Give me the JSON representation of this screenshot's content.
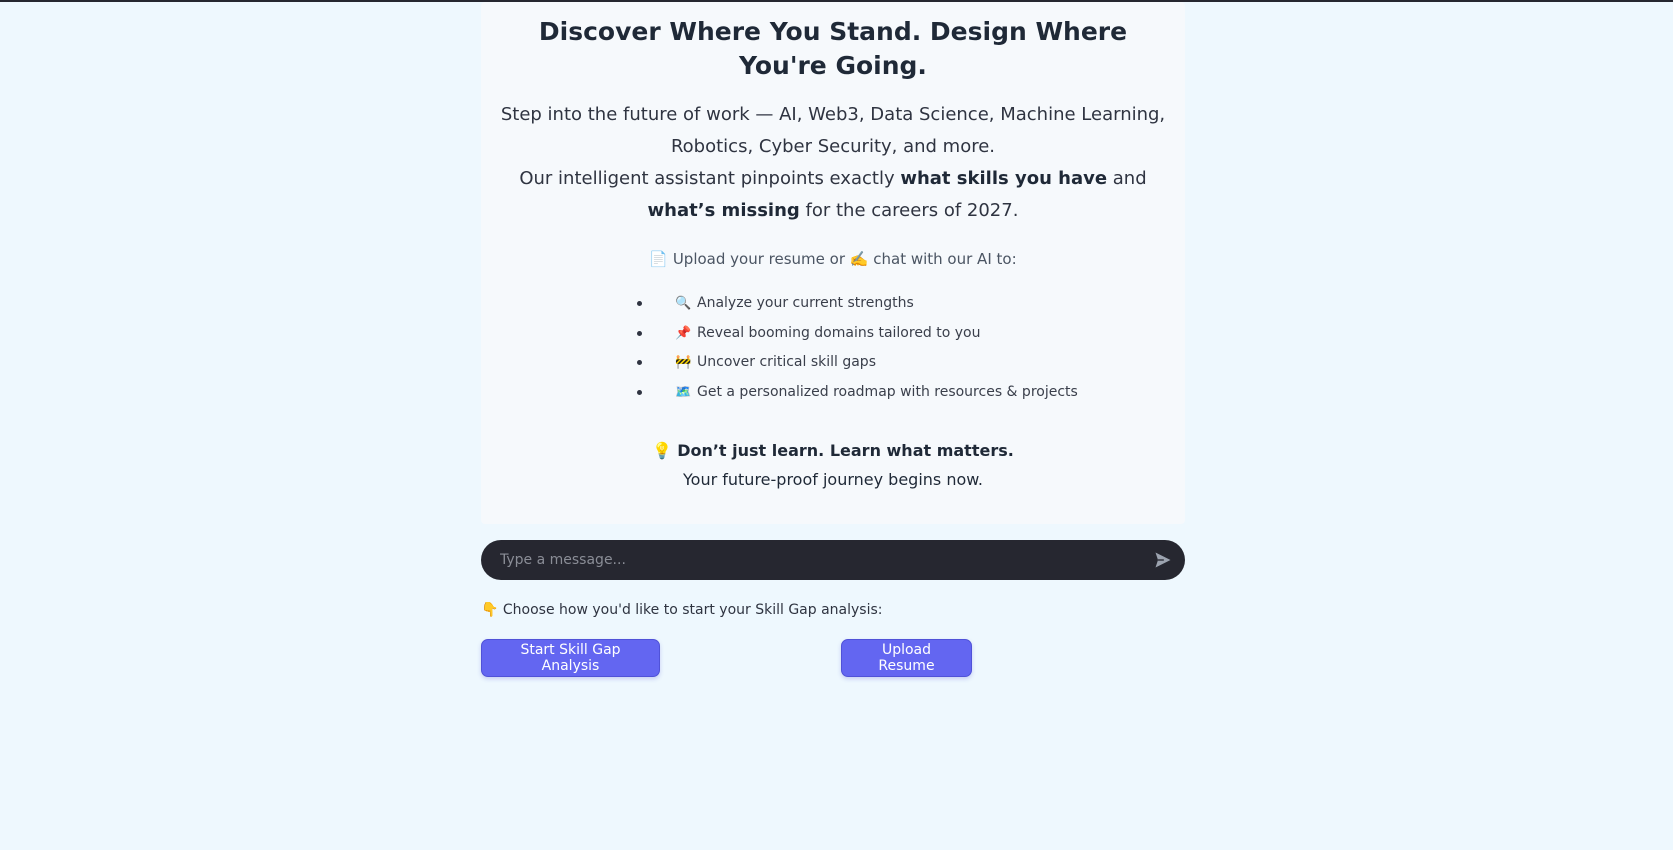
{
  "hero": {
    "title": "Discover Where You Stand. Design Where You're Going.",
    "intro_line1": "Step into the future of work — AI, Web3, Data Science, Machine Learning, Robotics, Cyber Security, and more.",
    "intro_line2_a": "Our intelligent assistant pinpoints exactly ",
    "intro_line2_b": "what skills you have",
    "intro_line2_c": " and ",
    "intro_line2_d": "what’s missing",
    "intro_line2_e": " for the careers of 2027.",
    "upload_icon": "📄",
    "upload_text": "Upload your resume or",
    "chat_icon": "✍️",
    "chat_text": "chat with our AI to:",
    "features": [
      {
        "icon": "🔍",
        "icon_name": "magnifier-icon",
        "text": "Analyze your current strengths"
      },
      {
        "icon": "📌",
        "icon_name": "pushpin-icon",
        "text": "Reveal booming domains tailored to you"
      },
      {
        "icon": "🚧",
        "icon_name": "construction-icon",
        "text": "Uncover critical skill gaps"
      },
      {
        "icon": "🗺️",
        "icon_name": "map-icon",
        "text": "Get a personalized roadmap with resources & projects"
      }
    ],
    "tagline_icon": "💡",
    "tagline_bold": "Don’t just learn. Learn what matters.",
    "tagline_sub": "Your future-proof journey begins now."
  },
  "chat": {
    "placeholder": "Type a message..."
  },
  "choose": {
    "icon": "👇",
    "text": "Choose how you'd like to start your Skill Gap analysis:"
  },
  "buttons": {
    "start_label": "Start Skill Gap Analysis",
    "upload_label": "Upload Resume"
  },
  "colors": {
    "background": "#eef8fe",
    "card": "#f6f9fc",
    "input_bg": "#262730",
    "accent": "#6366f1"
  }
}
